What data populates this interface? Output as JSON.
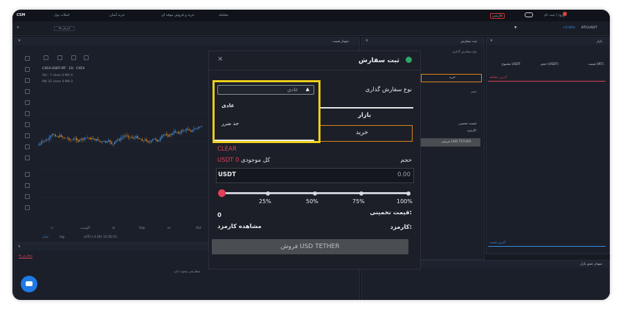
{
  "topbar": {
    "logo": "CSM",
    "menu_1": "اسلات پول",
    "menu_2": "خرید آسان",
    "menu_3": "خرید و فروش موقه ای",
    "menu_4": "معامله",
    "right_label": "ورود / ثبت نام",
    "lang": "فارسی"
  },
  "subbar": {
    "left_label": "ارزش ها",
    "pair": "BTC/USDT",
    "change": "+0.00%"
  },
  "chart": {
    "panel_title": "نمودار قیمت",
    "symbol_line": "CXEX:USDT-IRT · 1D · CXEX",
    "vol_line": "Vol · 7 close 0 MA 0",
    "ma_line": "MA 25 close 0 MA 0",
    "x_labels": [
      "۱۱",
      "اگوست",
      "۱۵",
      "Sep",
      "۱۵",
      "Oct"
    ],
    "footer_left": "تبادل",
    "footer_mid": "log",
    "footer_time": "(UTC+3:30) 15:56:15"
  },
  "bottom_left": {
    "tab": "سفارش ها",
    "empty_text": "سفارشی وجود ندارد"
  },
  "side_panel": {
    "title": "ثبت سفارش",
    "order_type_label": "نوع سفارش گذاری",
    "buy": "خرید",
    "price_label": "حجم",
    "estimated": "قیمت تخمینی:",
    "fee": "کارمزد:",
    "sell_btn": "فروش USD TETHER"
  },
  "market_panel": {
    "title": "بازار",
    "col_1": "قیمت (IRT)",
    "col_2": "حجم (USDT)",
    "col_3": "مجموع USDT",
    "spread_label": "آخرین معامله",
    "bottom_label": "آخرین قیمت",
    "depth_title": "نمودار عمق بازار"
  },
  "modal": {
    "title": "ثبت سفارش",
    "close": "×",
    "order_type_label": "نوع سفارش گذاری",
    "select_value": "عادی",
    "options": [
      "عادی",
      "حد ضرر"
    ],
    "tab_market": "بازار",
    "buy_button": "خرید",
    "clear": "CLEAR",
    "volume_label": "حجم",
    "balance_label": "کل موجودی",
    "balance_value": "USDT 0",
    "unit": "USDT",
    "amount_value": "0.00",
    "slider_marks": [
      "25%",
      "50%",
      "75%",
      "100%"
    ],
    "slider_value_percent": 0,
    "estimated_label": "قیمت تخمینی:",
    "estimated_value": "0",
    "fee_label": "کارمزد:",
    "fee_view": "مشاهده کارمزد",
    "sell_button": "فروش USD TETHER"
  },
  "colors": {
    "highlight": "#f0d11a",
    "clear": "#e0405a",
    "balance": "#e0405a",
    "accent_orange": "#e08a1e",
    "knob_active": "#e0405a"
  }
}
